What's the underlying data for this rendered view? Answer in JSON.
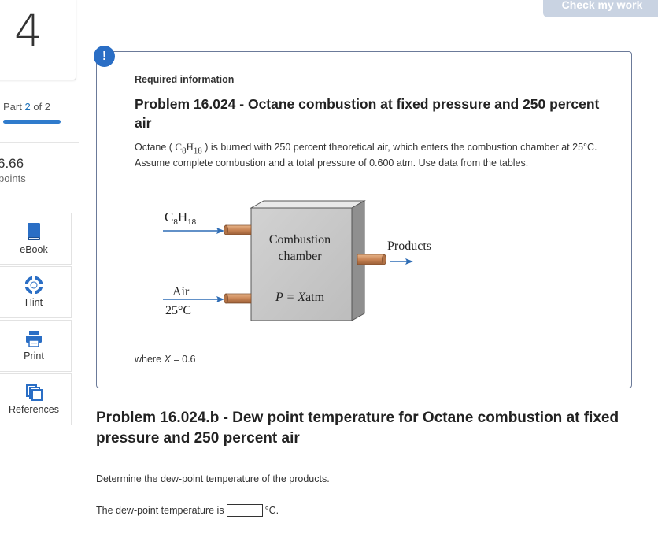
{
  "header": {
    "check_button": "Check my work"
  },
  "sidebar": {
    "question_number": "4",
    "part_prefix": "Part ",
    "part_current": "2",
    "part_suffix": " of 2",
    "part_progress": 1.0,
    "points_value": "6.66",
    "points_label": "points",
    "tools": [
      {
        "label": "eBook",
        "icon": "book-icon"
      },
      {
        "label": "Hint",
        "icon": "lifebuoy-icon"
      },
      {
        "label": "Print",
        "icon": "printer-icon"
      },
      {
        "label": "References",
        "icon": "documents-icon"
      }
    ]
  },
  "info": {
    "alert_glyph": "!",
    "required_label": "Required information",
    "title": "Problem 16.024 - Octane combustion at fixed pressure and 250 percent air",
    "text_before": "Octane ( ",
    "chem_c": "C",
    "chem_c_sub": "8",
    "chem_h": "H",
    "chem_h_sub": "18",
    "text_after": " ) is burned with 250 percent theoretical air, which enters the combustion chamber at 25°C. Assume complete combustion and a total pressure of 0.600 atm. Use data from the tables.",
    "where_prefix": "where ",
    "where_var": "X",
    "where_suffix": " = 0.6"
  },
  "diagram": {
    "fuel_c": "C",
    "fuel_c_sub": "8",
    "fuel_h": "H",
    "fuel_h_sub": "18",
    "chamber_line1": "Combustion",
    "chamber_line2": "chamber",
    "pressure_label": "P = ",
    "pressure_var": "X",
    "pressure_unit": "atm",
    "air_label": "Air",
    "air_temp": "25°C",
    "products_label": "Products"
  },
  "question": {
    "subtitle": "Problem 16.024.b - Dew point temperature for Octane combustion at fixed pressure and 250 percent air",
    "prompt": "Determine the dew-point temperature of the products.",
    "answer_prefix": "The dew-point temperature is",
    "answer_value": "",
    "answer_unit": "°C."
  },
  "colors": {
    "accent": "#2a6ec5",
    "arrow": "#2f6db5",
    "check_btn": "#c9d3e2"
  }
}
